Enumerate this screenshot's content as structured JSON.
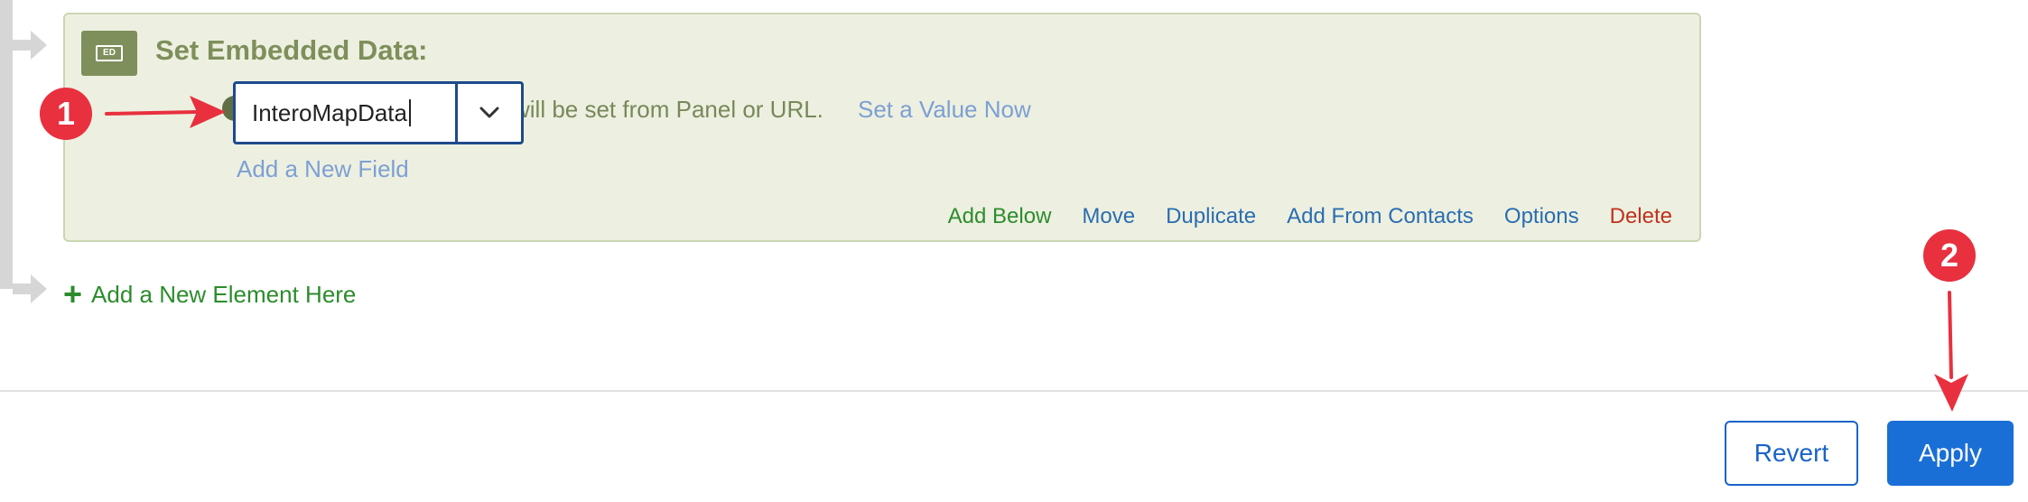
{
  "block": {
    "badge_text": "ED",
    "title": "Set Embedded Data:",
    "field": {
      "value": "InteroMapData",
      "row_text": "will be set from Panel or URL.",
      "set_value_link": "Set a Value Now"
    },
    "add_field_link": "Add a New Field",
    "actions": {
      "add_below": "Add Below",
      "move": "Move",
      "duplicate": "Duplicate",
      "add_from_contacts": "Add From Contacts",
      "options": "Options",
      "delete": "Delete"
    }
  },
  "add_element": {
    "label": "Add a New Element Here"
  },
  "footer": {
    "revert_label": "Revert",
    "apply_label": "Apply"
  },
  "annotations": {
    "callout_1": "1",
    "callout_2": "2"
  },
  "icons": {
    "dropdown": "chevron-down-icon",
    "add": "plus-icon",
    "badge": "embedded-data-icon"
  },
  "colors": {
    "block_bg": "#edf0e0",
    "block_accent": "#7e8f5b",
    "link_blue": "#2a6db0",
    "add_green": "#2c8c2c",
    "delete_red": "#c0321e",
    "primary_button": "#1a6fd6",
    "callout_red": "#e8303e"
  }
}
